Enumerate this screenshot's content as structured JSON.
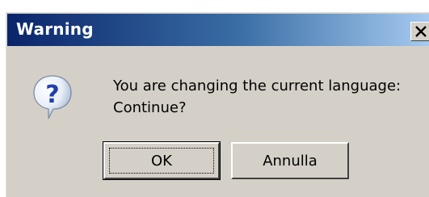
{
  "dialog": {
    "title": "Warning",
    "message_lines": [
      "You are changing the current language:",
      "Continue?"
    ],
    "buttons": {
      "ok_label": "OK",
      "cancel_label": "Annulla"
    },
    "icon": "question-icon",
    "close_icon": "close-icon"
  },
  "colors": {
    "title_start": "#0a246a",
    "title_end": "#a6caf0",
    "face": "#d4d0c8"
  }
}
